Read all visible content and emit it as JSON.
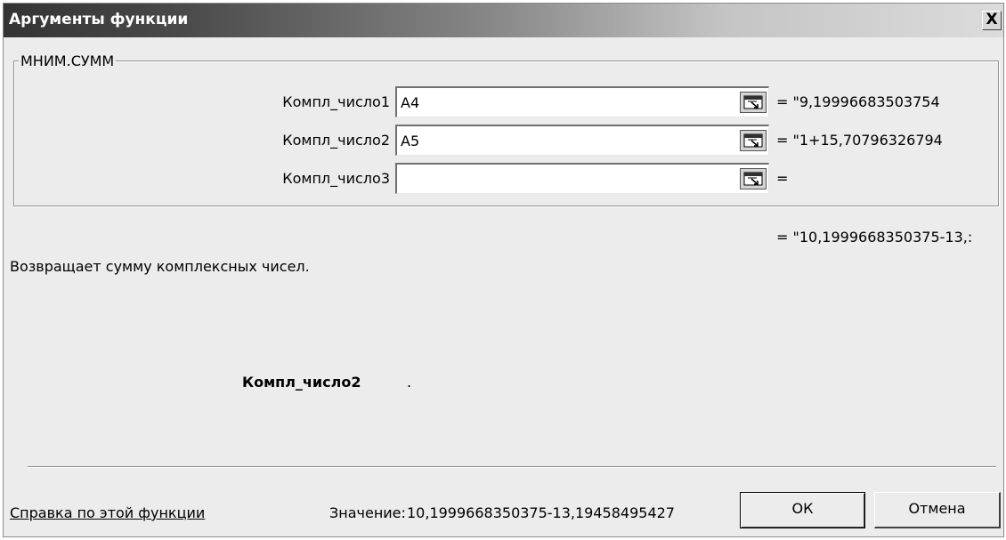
{
  "window": {
    "title": "Аргументы функции",
    "close_label": "X"
  },
  "function_group": {
    "name": "МНИМ.СУММ",
    "arguments": [
      {
        "label": "Компл_число1",
        "value": "A4",
        "result": "= \"9,19996683503754"
      },
      {
        "label": "Компл_число2",
        "value": "A5",
        "result": "= \"1+15,70796326794"
      },
      {
        "label": "Компл_число3",
        "value": "",
        "result": "="
      }
    ]
  },
  "overall_result": "= \"10,1999668350375-13,:",
  "description": "Возвращает сумму комплексных чисел.",
  "argument_help": {
    "name": "Компл_число2",
    "text": "."
  },
  "footer": {
    "help_link": "Справка по этой функции",
    "value_label": "Значение:",
    "value_text": "10,1999668350375-13,19458495427",
    "ok_label": "ОК",
    "cancel_label": "Отмена"
  },
  "icons": {
    "collapse": "collapse-dialog-icon",
    "close": "close-icon"
  }
}
